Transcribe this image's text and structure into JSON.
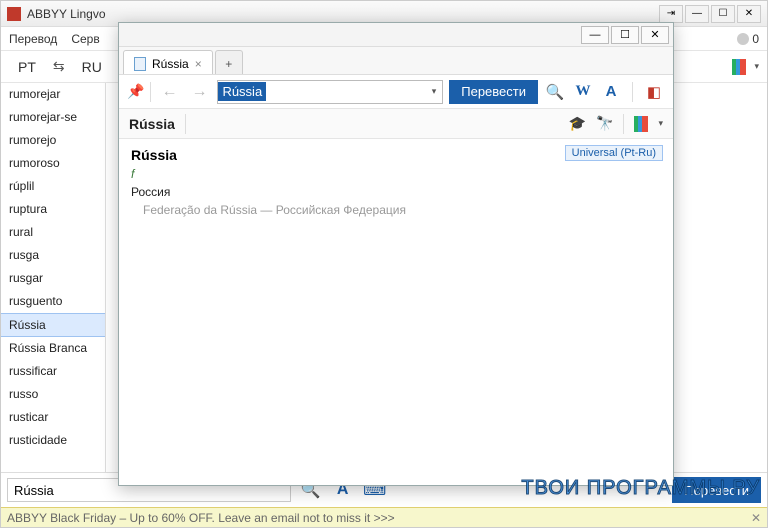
{
  "app": {
    "title": "ABBYY Lingvo"
  },
  "menu": {
    "items": [
      "Перевод",
      "Серв"
    ],
    "user_count": "0"
  },
  "langbar": {
    "src": "PT",
    "dst": "RU"
  },
  "wordlist": {
    "items": [
      "rumorejar",
      "rumorejar-se",
      "rumorejo",
      "rumoroso",
      "rúplil",
      "ruptura",
      "rural",
      "rusga",
      "rusgar",
      "rusguento",
      "Rússia",
      "Rússia Branca",
      "russificar",
      "russo",
      "rusticar",
      "rusticidade"
    ],
    "selected_index": 10
  },
  "bottom": {
    "search_value": "Rússia",
    "translate_label": "Перевести"
  },
  "status": {
    "text": "ABBYY Black Friday – Up to 60% OFF. Leave an email not to miss it >>>"
  },
  "card": {
    "tab_label": "Rússia",
    "input_value": "Rússia",
    "translate_label": "Перевести",
    "headword": "Rússia",
    "dict_tag": "Universal (Pt-Ru)",
    "article": {
      "head": "Rússia",
      "gram": "f",
      "translation": "Россия",
      "example": "Federação da Rússia — Российская Федерация"
    }
  },
  "watermark": "ТВОИ ПРОГРАММЫ РУ"
}
